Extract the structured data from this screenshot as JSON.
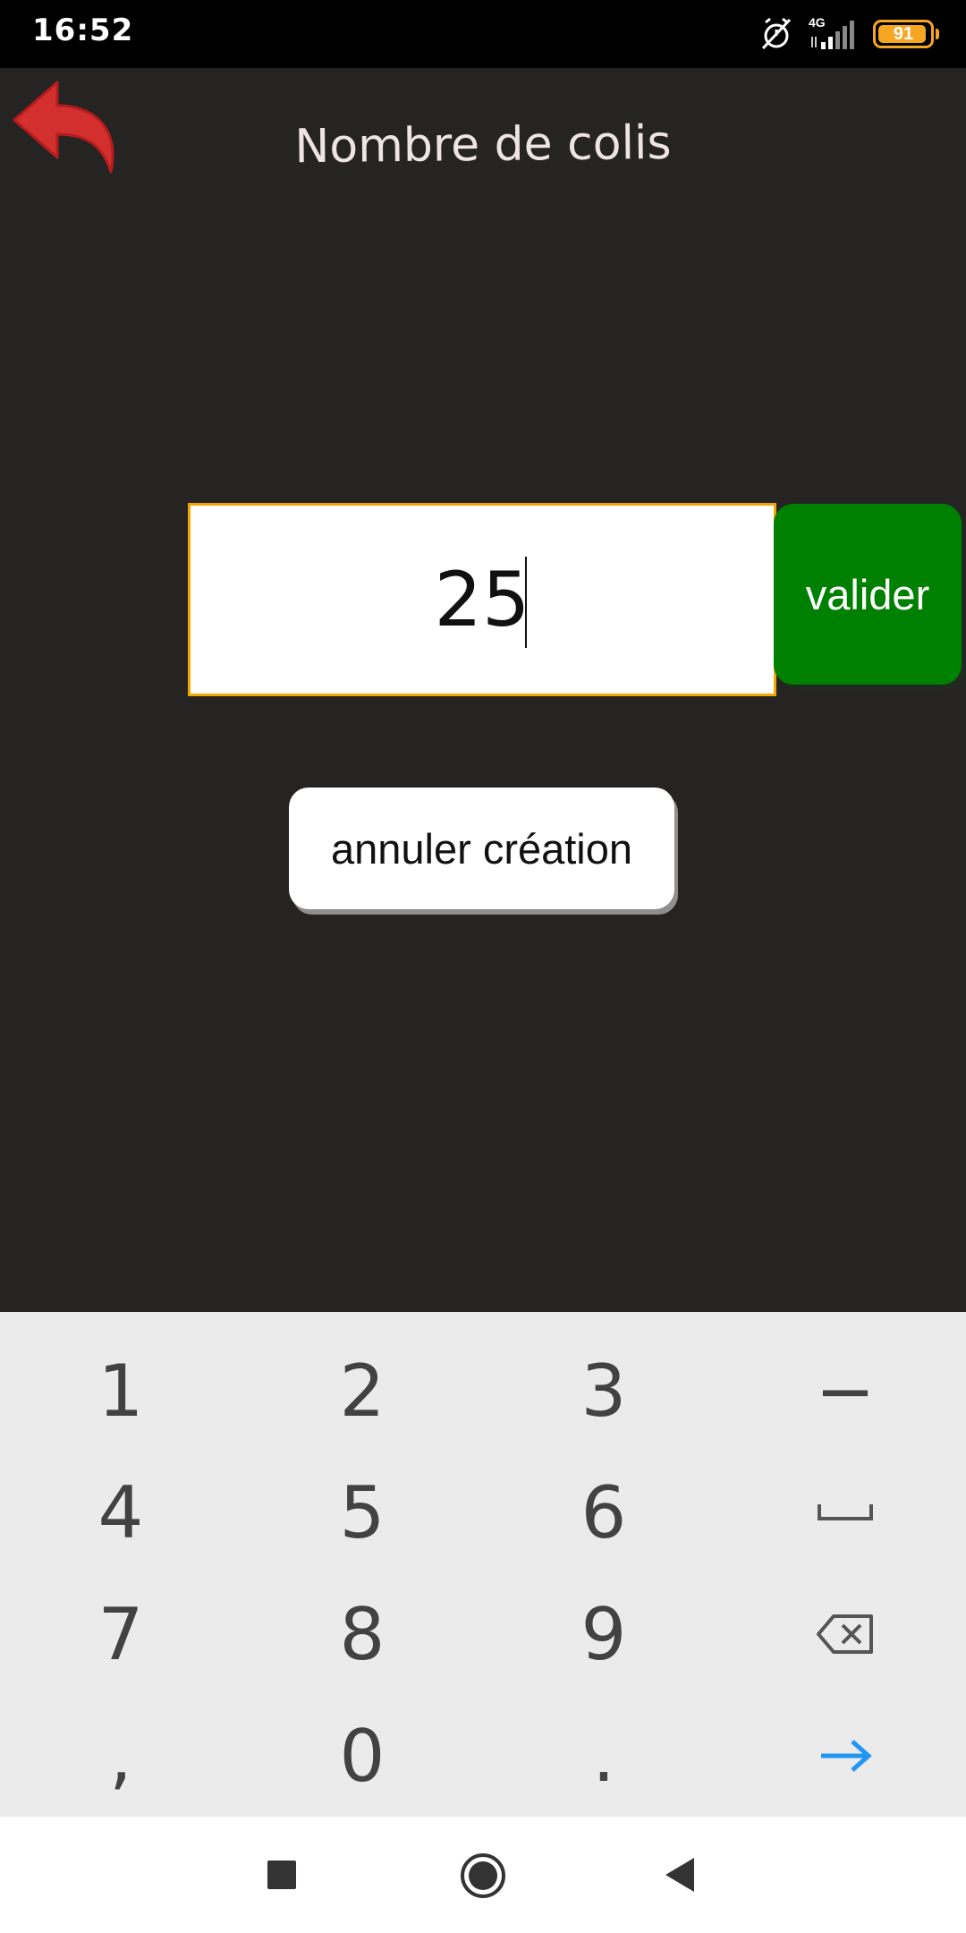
{
  "status_bar": {
    "time": "16:52",
    "network": "4G",
    "battery_level": "91"
  },
  "header": {
    "title": "Nombre de colis",
    "back_icon": "back-arrow-icon",
    "back_color": "#d32f2f"
  },
  "form": {
    "quantity_value": "25",
    "validate_label": "valider",
    "validate_color": "#008000",
    "cancel_label": "annuler création",
    "input_border_color": "#f2a600"
  },
  "keyboard": {
    "rows": [
      [
        "1",
        "2",
        "3",
        "−"
      ],
      [
        "4",
        "5",
        "6",
        "space-icon"
      ],
      [
        "7",
        "8",
        "9",
        "backspace-icon"
      ],
      [
        ",",
        "0",
        ".",
        "enter-arrow-icon"
      ]
    ],
    "key_1": "1",
    "key_2": "2",
    "key_3": "3",
    "key_minus": "−",
    "key_4": "4",
    "key_5": "5",
    "key_6": "6",
    "key_7": "7",
    "key_8": "8",
    "key_9": "9",
    "key_comma": ",",
    "key_0": "0",
    "key_dot": ".",
    "enter_color": "#2196f3"
  },
  "nav_bar": {
    "buttons": [
      "recents-icon",
      "home-icon",
      "back-icon"
    ]
  },
  "colors": {
    "background": "#262323",
    "keyboard_bg": "#ebebeb"
  }
}
